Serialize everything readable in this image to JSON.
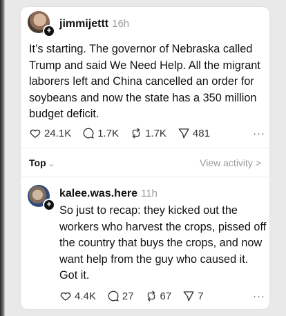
{
  "post": {
    "username": "jimmijettt",
    "time": "16h",
    "text": "It’s starting. The governor of Nebraska called Trump and said We Need Help. All the migrant laborers left and China cancelled an order for soybeans and now the state has a 350 million budget deficit.",
    "likes": "24.1K",
    "replies": "1.7K",
    "reposts": "1.7K",
    "shares": "481",
    "more": "···"
  },
  "sort": {
    "label": "Top",
    "chevron": "⌄",
    "view_activity": "View activity >"
  },
  "reply": {
    "username": "kalee.was.here",
    "time": "11h",
    "text": "So just to recap: they kicked out the workers who harvest the crops, pissed off the country that buys the crops, and now want help from the guy who caused it. Got it.",
    "likes": "4.4K",
    "replies": "27",
    "reposts": "67",
    "shares": "7",
    "more": "···"
  },
  "icons": {
    "heart": "heart-icon",
    "comment": "comment-icon",
    "repost": "repost-icon",
    "share": "share-icon",
    "plus": "+"
  }
}
